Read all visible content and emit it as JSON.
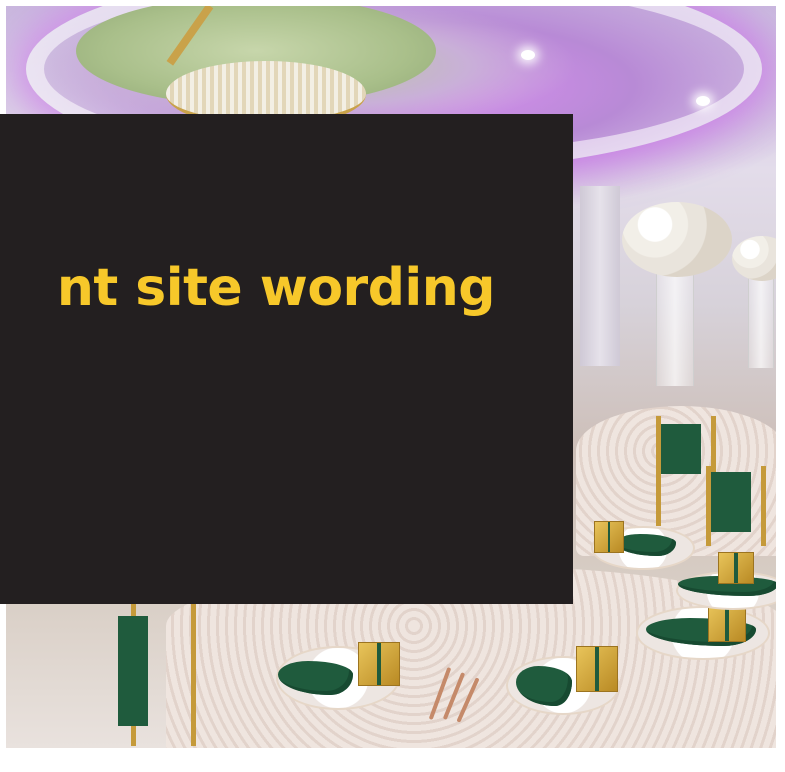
{
  "banner": {
    "headline": "nt site wording",
    "headline_color": "#f7c82a",
    "overlay_color": "#231f20"
  },
  "photo": {
    "scene": "banquet-hall-image"
  }
}
